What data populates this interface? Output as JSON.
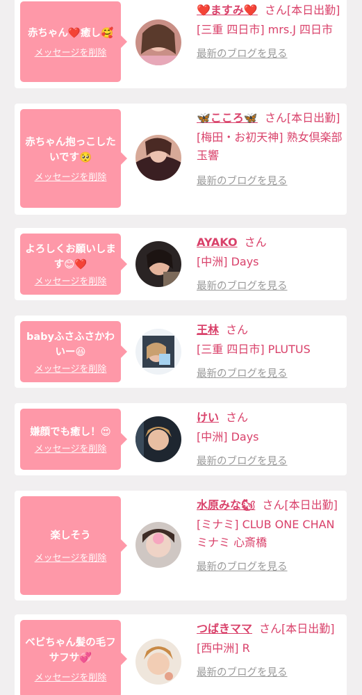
{
  "cards": [
    {
      "message": "赤ちゃん❤️癒し🥰",
      "delete_label": "メッセージを削除",
      "name": "❤️ますみ❤️",
      "san": "さん",
      "status": "[本日出勤]",
      "shop": "[三重 四日市] mrs.J 四日市",
      "blog_label": "最新のブログを見る"
    },
    {
      "message": "赤ちゃん抱っこしたいです🥺",
      "delete_label": "メッセージを削除",
      "name": "🦋こころ🦋",
      "san": "さん",
      "status": "[本日出勤]",
      "shop": "[梅田・お初天神] 熟女倶楽部 玉響",
      "blog_label": "最新のブログを見る"
    },
    {
      "message": "よろしくお願いします😊❤️",
      "delete_label": "メッセージを削除",
      "name": "AYAKO",
      "san": "さん",
      "status": "",
      "shop": "[中洲] Days",
      "blog_label": "最新のブログを見る"
    },
    {
      "message": "babyふさふさかわいー😆",
      "delete_label": "メッセージを削除",
      "name": "王林",
      "san": "さん",
      "status": "",
      "shop": "[三重 四日市] PLUTUS",
      "blog_label": "最新のブログを見る"
    },
    {
      "message": "嫌顔でも癒し！😍",
      "delete_label": "メッセージを削除",
      "name": "けい",
      "san": "さん",
      "status": "",
      "shop": "[中洲] Days",
      "blog_label": "最新のブログを見る"
    },
    {
      "message": "楽しそう",
      "delete_label": "メッセージを削除",
      "name": "水原みな🐿",
      "san": "さん",
      "status": "[本日出勤]",
      "shop": "[ミナミ] CLUB ONE CHAN ミナミ 心斎橋",
      "blog_label": "最新のブログを見る"
    },
    {
      "message": "ベビちゃん髪の毛フサフサ💞",
      "delete_label": "メッセージを削除",
      "name": "つばきママ",
      "san": "さん",
      "status": "[本日出勤]",
      "shop": "[西中洲] R",
      "blog_label": "最新のブログを見る"
    }
  ],
  "colors": {
    "bubble": "#fe98a8",
    "name": "#d9416a",
    "link_gray": "#9a9a9a",
    "background": "#f1eff0"
  }
}
